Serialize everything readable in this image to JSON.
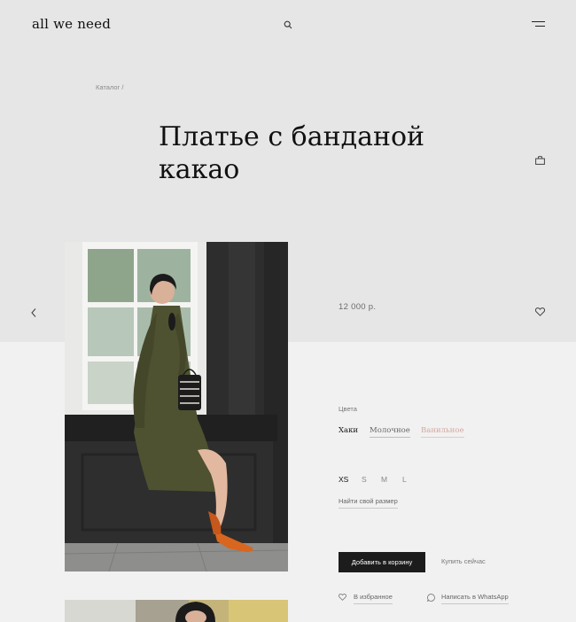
{
  "header": {
    "logo": "all we need",
    "icons": [
      "search-icon",
      "menu-icon"
    ]
  },
  "breadcrumb": "Каталог /",
  "product": {
    "title": "Платье с банданой какао",
    "price": "12 000 р.",
    "colors_label": "Цвета",
    "colors": [
      "Хаки",
      "Молочное",
      "Ванильное"
    ],
    "sizes": [
      "XS",
      "S",
      "M",
      "L"
    ],
    "find_size": "Найти свой размер",
    "add_to_cart": "Добавить в корзину",
    "buy_now": "Купить сейчас",
    "favorites": "В избранное",
    "whatsapp": "Написать в WhatsApp"
  },
  "colors": {
    "band": "#e6e6e6",
    "background": "#f1f1f1",
    "button": "#1c1c1c",
    "dress": "#4f5230",
    "shoes": "#d9661e"
  }
}
